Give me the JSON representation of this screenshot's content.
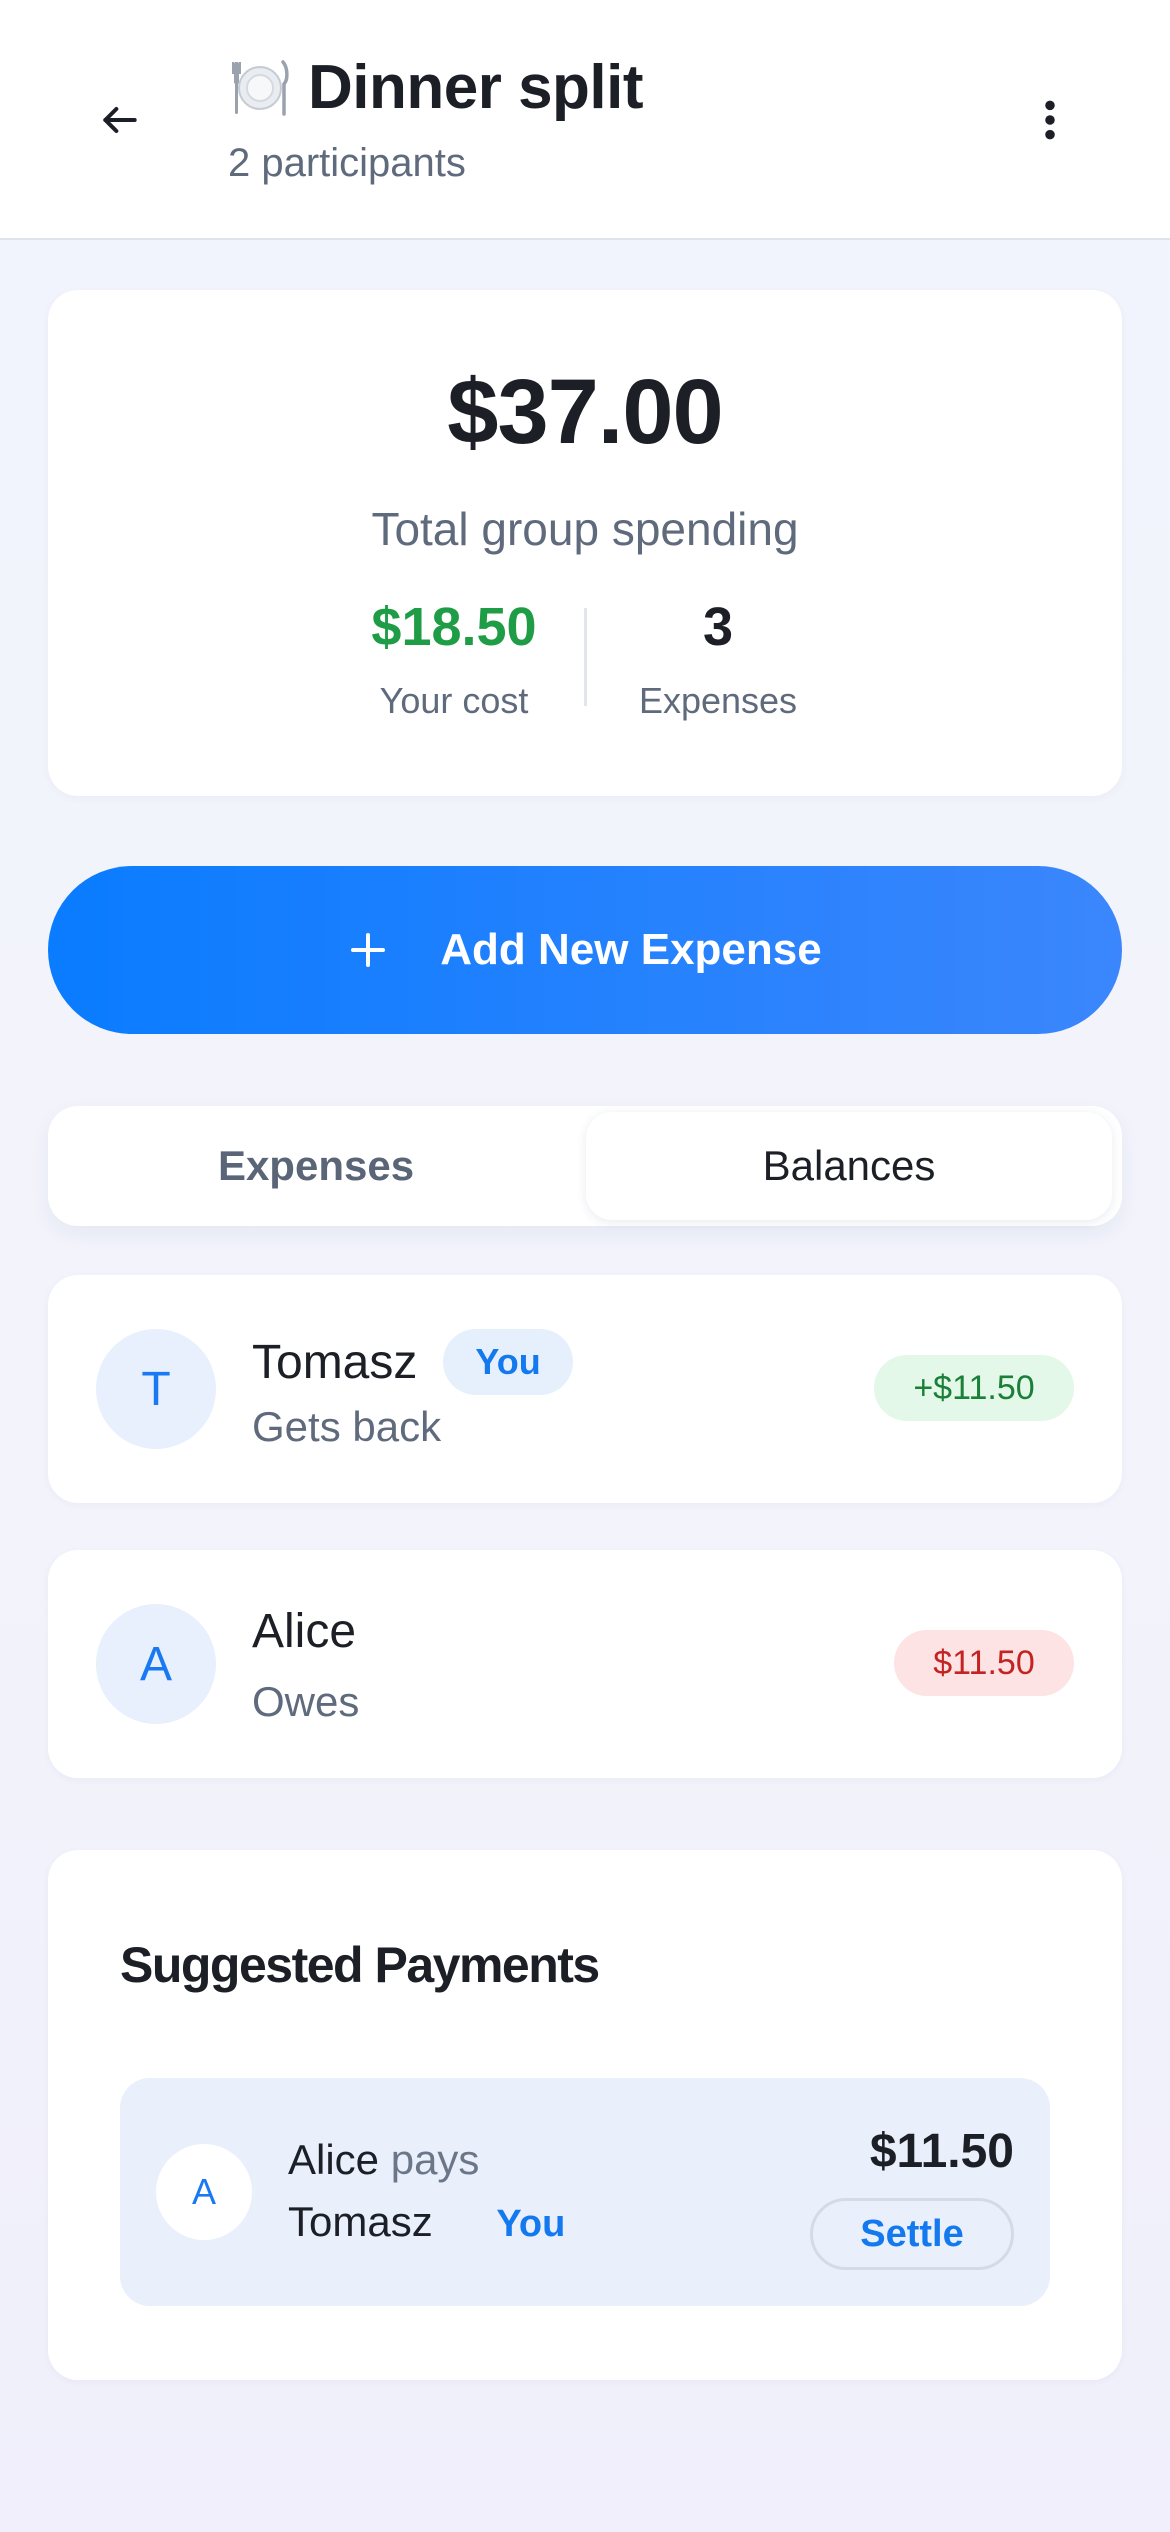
{
  "header": {
    "title": "Dinner split",
    "subtitle": "2 participants",
    "icons": {
      "back": "arrow-left-icon",
      "title": "plate-cutlery-icon",
      "menu": "more-vertical-icon"
    }
  },
  "summary": {
    "total": "$37.00",
    "total_label": "Total group spending",
    "your_cost_value": "$18.50",
    "your_cost_label": "Your cost",
    "expenses_value": "3",
    "expenses_label": "Expenses"
  },
  "add_button": {
    "label": "Add New Expense",
    "icon": "plus-icon"
  },
  "tabs": [
    {
      "label": "Expenses",
      "active": false
    },
    {
      "label": "Balances",
      "active": true
    }
  ],
  "balances": [
    {
      "initial": "T",
      "name": "Tomasz",
      "badge": "You",
      "status": "Gets back",
      "amount": "+$11.50",
      "tone": "positive"
    },
    {
      "initial": "A",
      "name": "Alice",
      "badge": "",
      "status": "Owes",
      "amount": "$11.50",
      "tone": "negative"
    }
  ],
  "suggested": {
    "title": "Suggested Payments",
    "payments": [
      {
        "initial": "A",
        "from": "Alice",
        "verb": "pays",
        "to": "Tomasz",
        "to_badge": "You",
        "amount": "$11.50",
        "action": "Settle"
      }
    ]
  },
  "colors": {
    "accent": "#0a7cff",
    "positive": "#1e9d46",
    "negative": "#c42323",
    "text": "#1c1f26",
    "muted": "#5f6b7d"
  }
}
